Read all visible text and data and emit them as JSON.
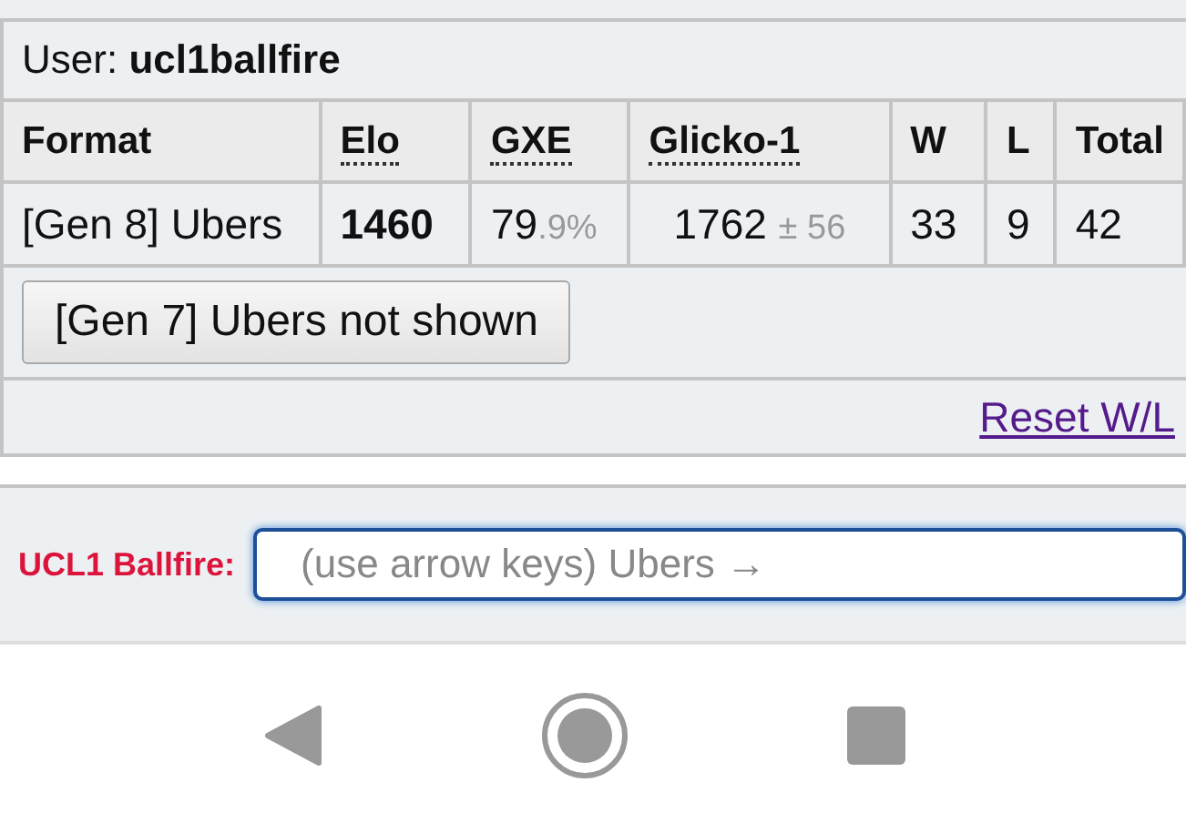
{
  "user": {
    "label": "User:",
    "name": "ucl1ballfire"
  },
  "table": {
    "columns": [
      {
        "label": "Format",
        "abbr": false
      },
      {
        "label": "Elo",
        "abbr": true
      },
      {
        "label": "GXE",
        "abbr": true
      },
      {
        "label": "Glicko-1",
        "abbr": true
      },
      {
        "label": "W",
        "abbr": false
      },
      {
        "label": "L",
        "abbr": false
      },
      {
        "label": "Total",
        "abbr": false
      }
    ],
    "rows": [
      {
        "format": "[Gen 8] Ubers",
        "elo": "1460",
        "gxe": "79",
        "gxe_decimal": ".9%",
        "glicko": "1762",
        "glicko_deviation": "± 56",
        "w": "33",
        "l": "9",
        "total": "42"
      }
    ]
  },
  "hidden_format_button": "[Gen 7] Ubers not shown",
  "reset_link": "Reset W/L",
  "chat": {
    "name": "UCL1 Ballfire:",
    "placeholder": "(use arrow keys) Ubers →"
  }
}
